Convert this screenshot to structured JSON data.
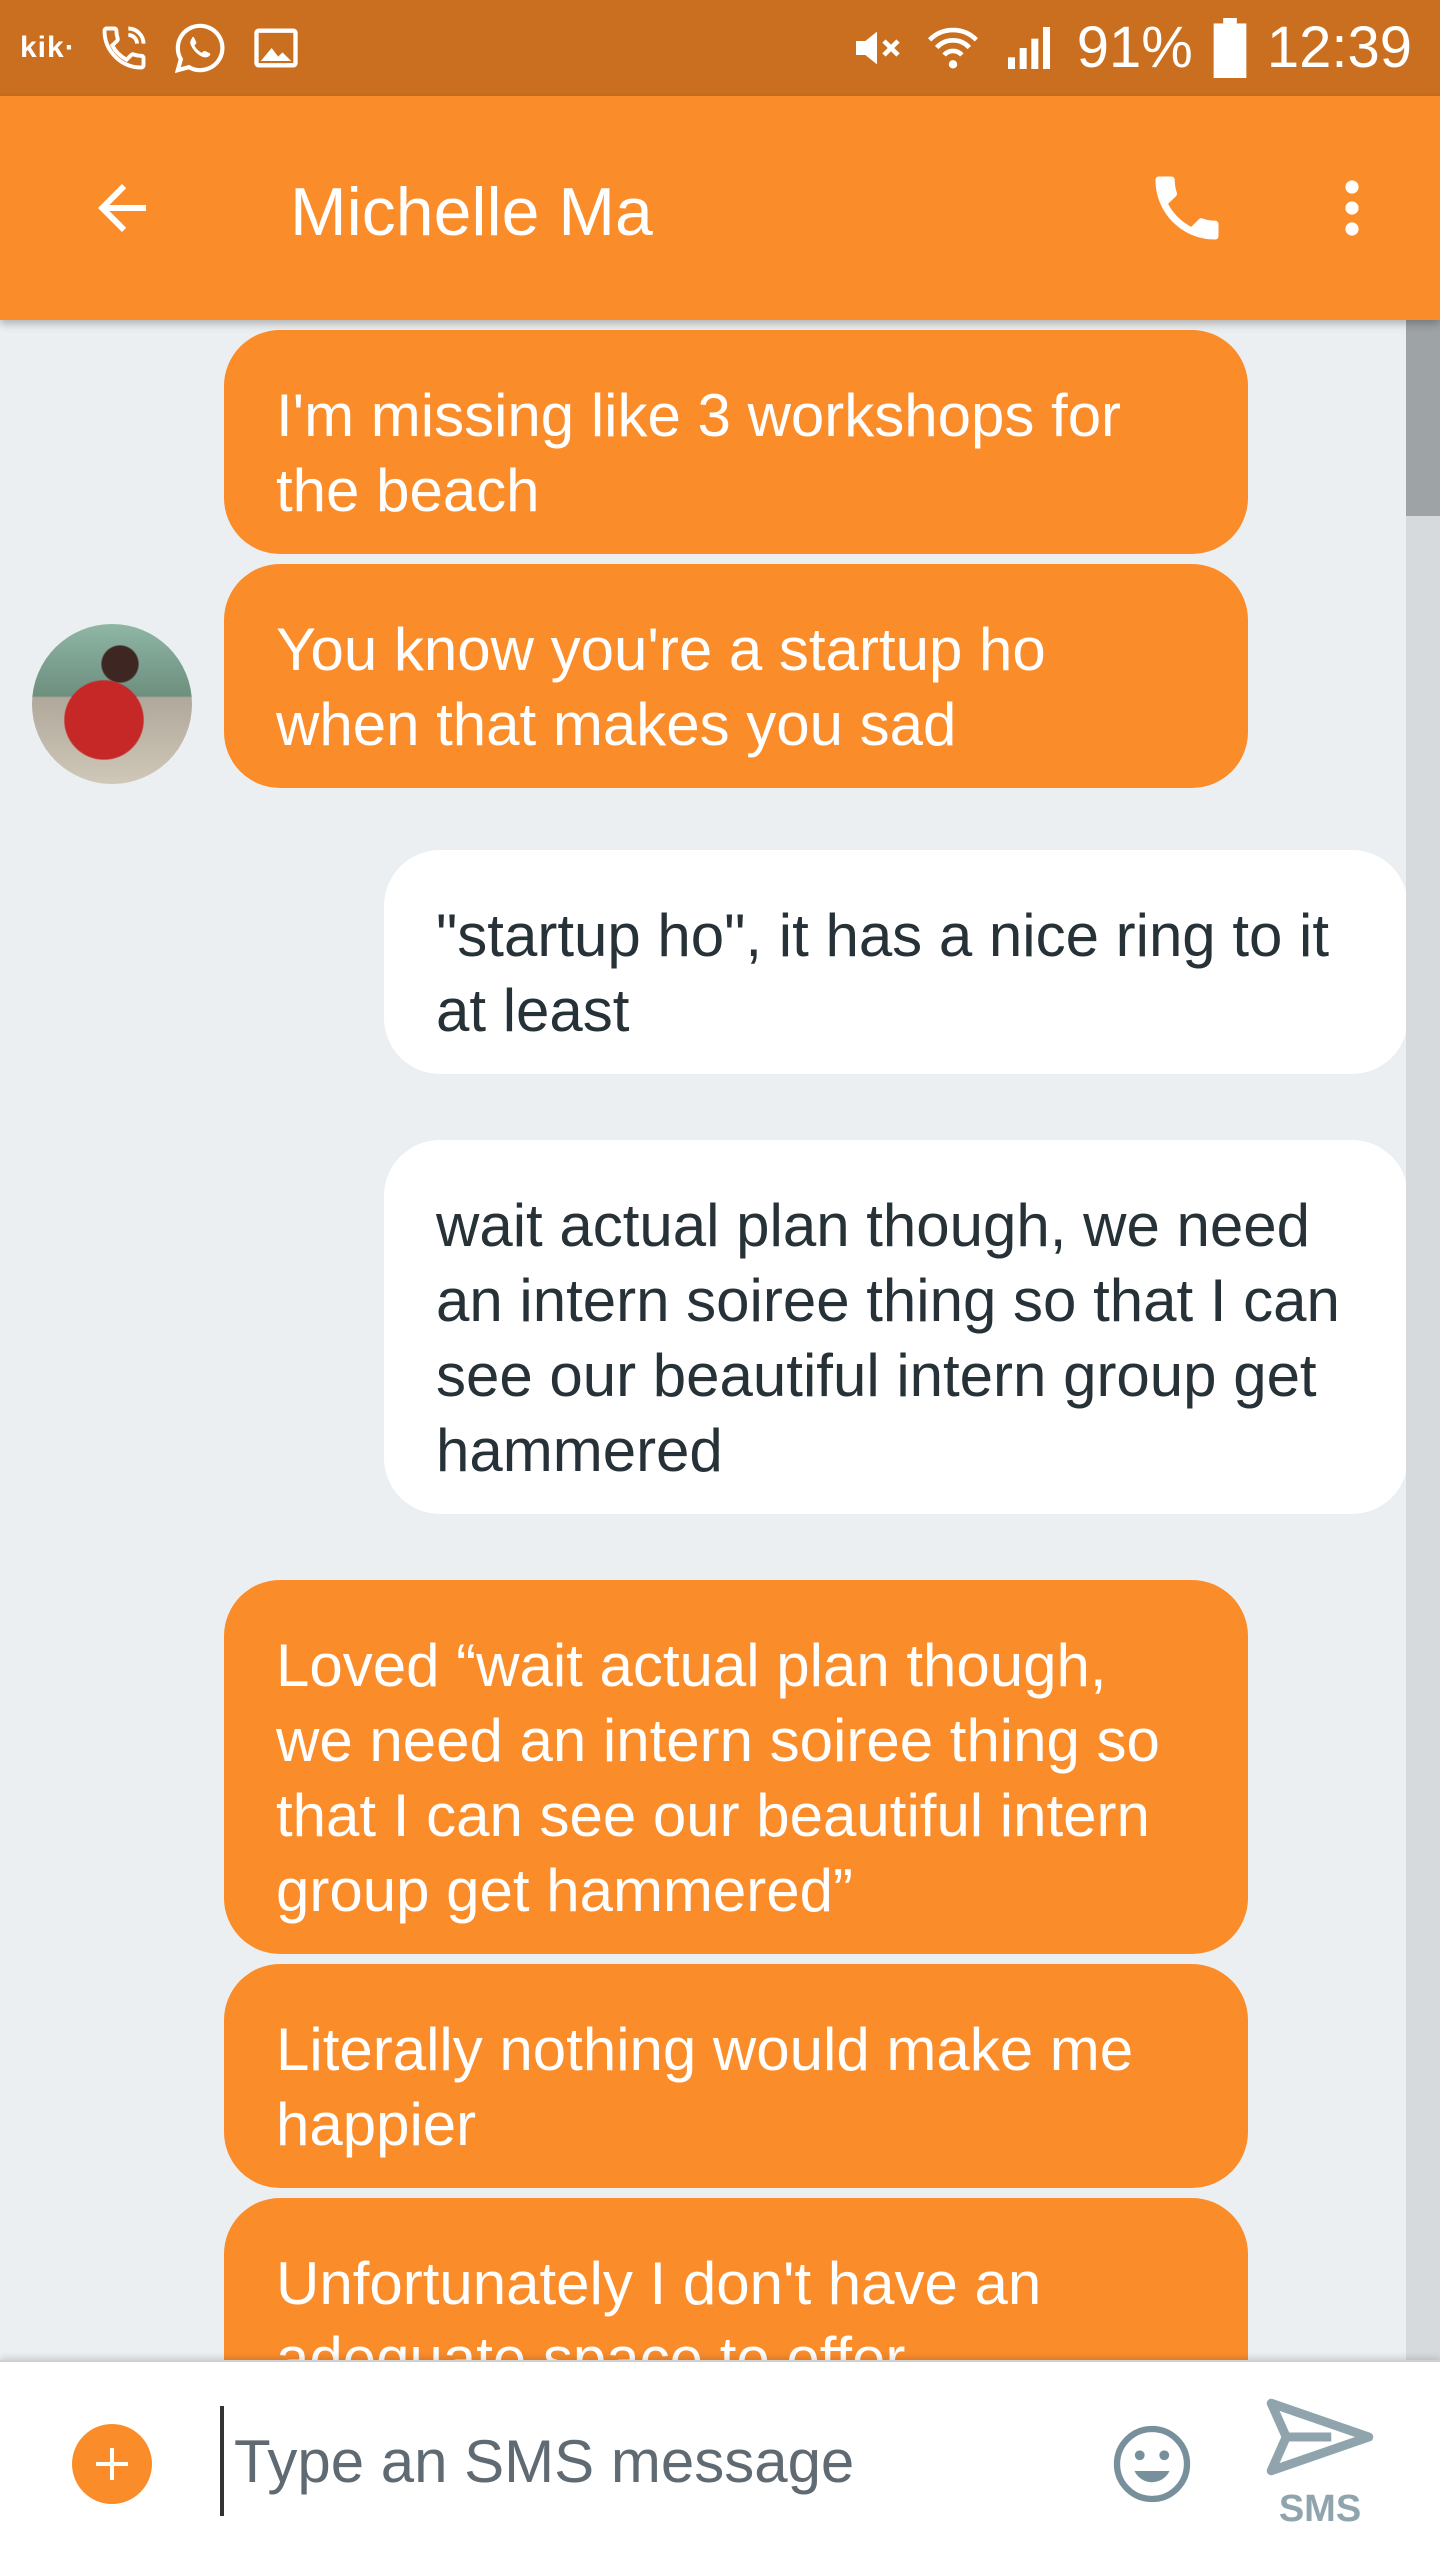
{
  "status_bar": {
    "kik_label": "kik·",
    "battery": "91%",
    "time": "12:39"
  },
  "app_bar": {
    "contact_name": "Michelle Ma",
    "icons": [
      "back-arrow-icon",
      "phone-icon",
      "more-vert-icon"
    ]
  },
  "messages": [
    {
      "direction": "incoming",
      "text": "I'm missing like 3 workshops for the beach"
    },
    {
      "direction": "incoming",
      "text": "You know you're a startup ho when that makes you sad"
    },
    {
      "direction": "outgoing",
      "text": "\"startup ho\", it has a nice ring to it at least"
    },
    {
      "direction": "outgoing",
      "text": "wait actual plan though, we need an intern soiree thing so that I can see our beautiful intern group get hammered"
    },
    {
      "direction": "incoming",
      "text": "Loved “wait actual plan though, we need an intern soiree thing so that I can see our beautiful intern group get hammered”"
    },
    {
      "direction": "incoming",
      "text": "Literally nothing would make me happier"
    },
    {
      "direction": "incoming",
      "text": "Unfortunately I don't have an adequate space to offer"
    }
  ],
  "composer": {
    "placeholder": "Type an SMS message",
    "send_label": "SMS"
  },
  "colors": {
    "status_bar": "#c96f1f",
    "accent": "#fb8c2a",
    "background": "#eceff1",
    "outgoing_bubble": "#ffffff"
  }
}
